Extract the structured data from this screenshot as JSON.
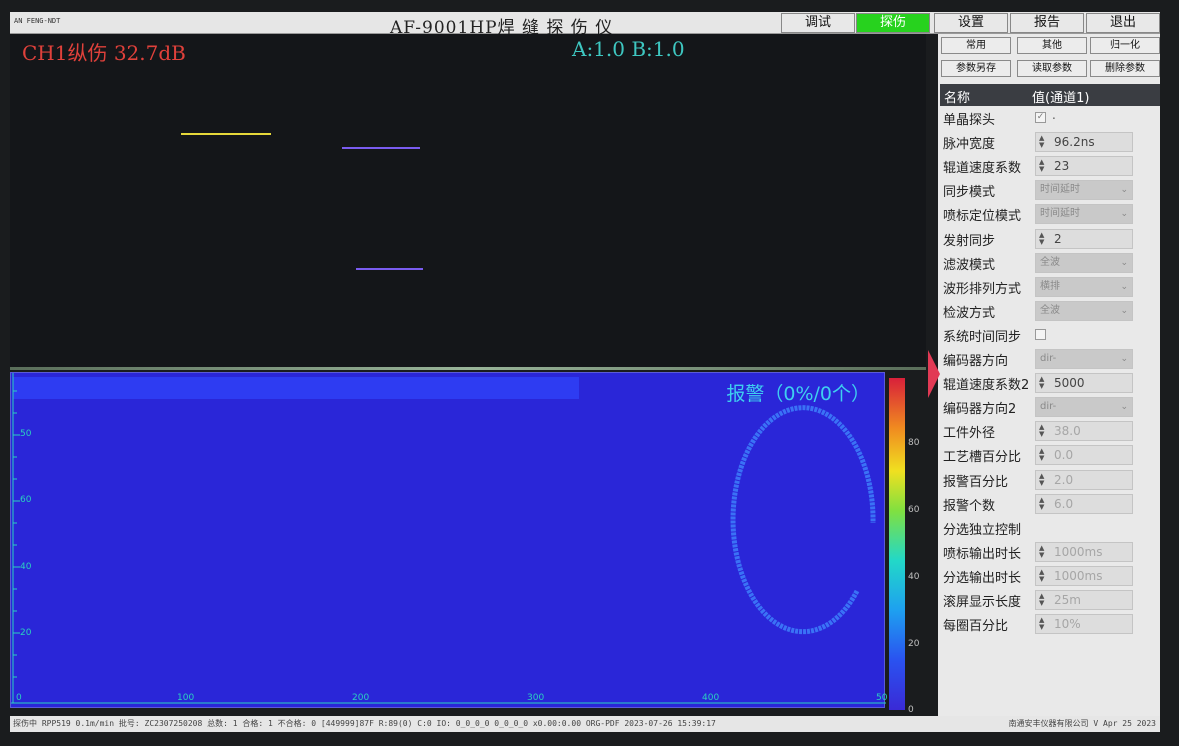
{
  "topbar": {
    "brand": "AN FENG-NDT",
    "title": "AF-9001HP焊 缝 探 伤 仪",
    "nav": [
      {
        "label": "调试",
        "active": false
      },
      {
        "label": "探伤",
        "active": true
      },
      {
        "label": "设置",
        "active": false
      },
      {
        "label": "报告",
        "active": false
      },
      {
        "label": "退出",
        "active": false
      }
    ]
  },
  "ascan": {
    "gain_text": "CH1纵伤 32.7dB",
    "ab_text": "A:1.0 B:1.0"
  },
  "cscan": {
    "alarm_text": "报警（0%/0个）",
    "x_ticks": [
      "0",
      "100",
      "200",
      "300",
      "400",
      "50"
    ],
    "y_ticks": [
      "50",
      "60",
      "40",
      "20"
    ]
  },
  "colorbar_ticks": [
    "80",
    "60",
    "40",
    "20",
    "0"
  ],
  "panel": {
    "buttons_row1": [
      "常用",
      "其他",
      "归一化"
    ],
    "buttons_row2": [
      "参数另存",
      "读取参数",
      "删除参数"
    ],
    "header_name": "名称",
    "header_value": "值(通道1)",
    "rows": [
      {
        "name": "单晶探头",
        "kind": "check",
        "value": "."
      },
      {
        "name": "脉冲宽度",
        "kind": "spin",
        "value": "96.2ns"
      },
      {
        "name": "辊道速度系数",
        "kind": "spin",
        "value": "23"
      },
      {
        "name": "同步模式",
        "kind": "combo",
        "value": "时间延时"
      },
      {
        "name": "喷标定位模式",
        "kind": "combo",
        "value": "时间延时"
      },
      {
        "name": "发射同步",
        "kind": "spin",
        "value": "2"
      },
      {
        "name": "滤波模式",
        "kind": "combo",
        "value": "全波"
      },
      {
        "name": "波形排列方式",
        "kind": "combo",
        "value": "横排"
      },
      {
        "name": "检波方式",
        "kind": "combo",
        "value": "全波"
      },
      {
        "name": "系统时间同步",
        "kind": "check",
        "value": ""
      },
      {
        "name": "编码器方向",
        "kind": "combo",
        "value": "dir-"
      },
      {
        "name": "辊道速度系数2",
        "kind": "spin",
        "value": "5000"
      },
      {
        "name": "编码器方向2",
        "kind": "combo",
        "value": "dir-"
      },
      {
        "name": "工件外径",
        "kind": "spin-dim",
        "value": "38.0"
      },
      {
        "name": "工艺槽百分比",
        "kind": "spin-dim",
        "value": "0.0"
      },
      {
        "name": "报警百分比",
        "kind": "spin-dim",
        "value": "2.0"
      },
      {
        "name": "报警个数",
        "kind": "spin-dim",
        "value": "6.0"
      },
      {
        "name": "分选独立控制",
        "kind": "none",
        "value": ""
      },
      {
        "name": "喷标输出时长",
        "kind": "spin-dim",
        "value": "1000ms"
      },
      {
        "name": "分选输出时长",
        "kind": "spin-dim",
        "value": "1000ms"
      },
      {
        "name": "滚屏显示长度",
        "kind": "spin-dim",
        "value": "25m"
      },
      {
        "name": "每圈百分比",
        "kind": "spin-dim",
        "value": "10%"
      }
    ]
  },
  "status": {
    "left": "探伤中 RPP519 0.1m/min 批号: ZC2307250208 总数: 1 合格: 1 不合格: 0 [449999]87F R:89(0) C:0 IO: 0_0_0_0 0_0_0_0 x0.00:0.00  ORG-PDF 2023-07-26 15:39:17",
    "right": "南通安丰仪器有限公司 V Apr 25 2023"
  },
  "colors": {
    "accent_active": "#27d21e",
    "gain_text": "#e0413b",
    "ab_text": "#3ec7c1",
    "cscan_bg": "#2a26d8",
    "gate_a": "#e6d83a",
    "gate_b": "#7a5cf0",
    "pointer": "#e23a55"
  }
}
